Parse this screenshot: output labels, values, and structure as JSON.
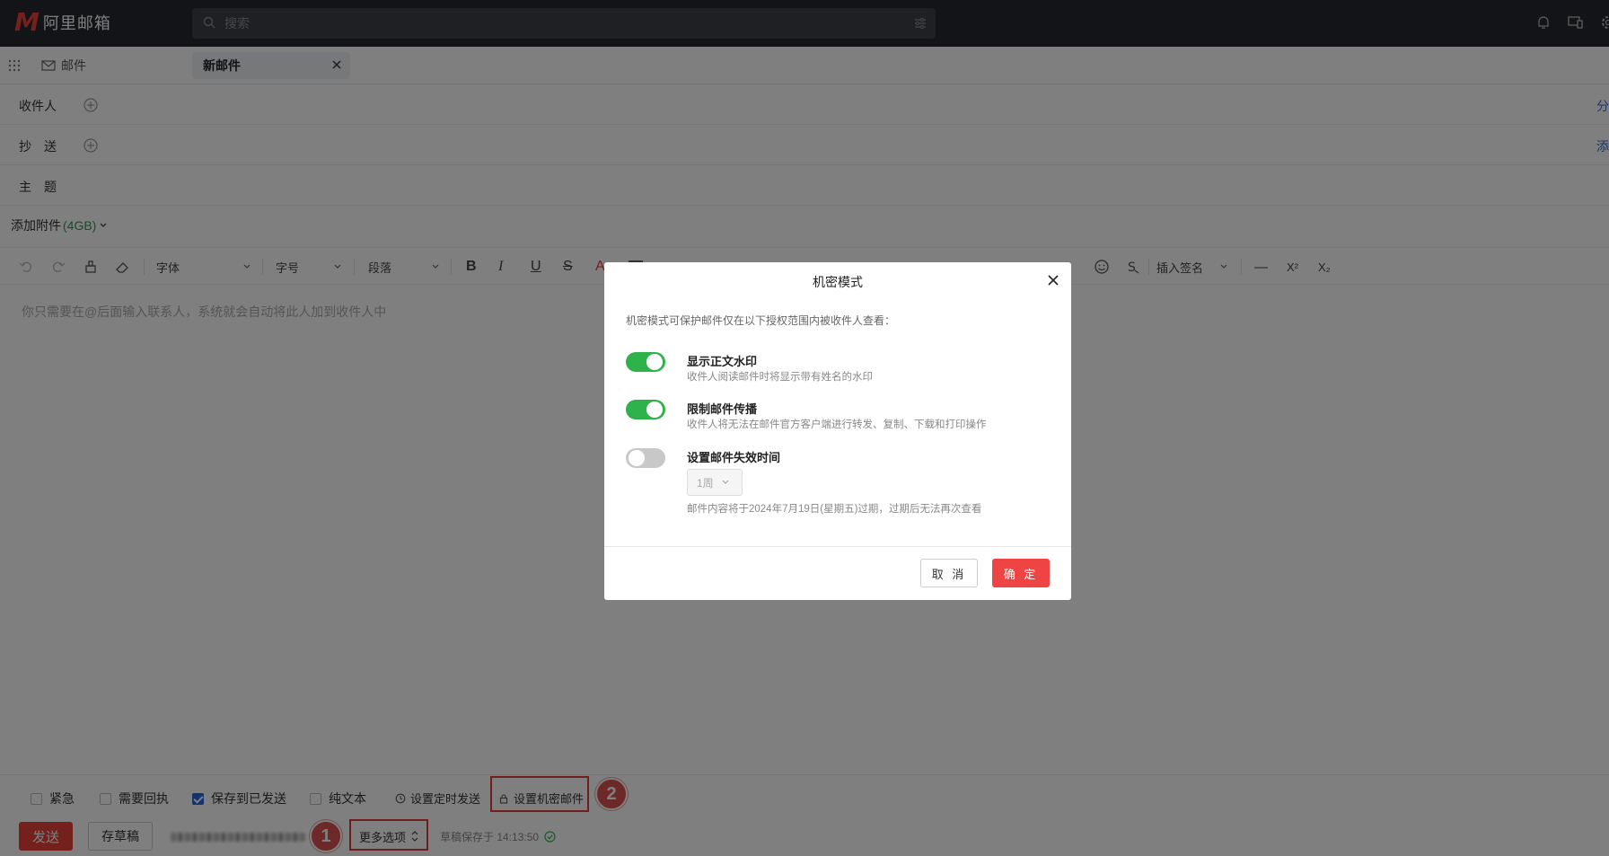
{
  "app": {
    "logo_letter": "M",
    "logo_text": "阿里邮箱",
    "brand_color": "#e8413a"
  },
  "search": {
    "placeholder": "搜索"
  },
  "tabs": {
    "mail_label": "邮件",
    "new_mail_label": "新邮件"
  },
  "compose": {
    "to_label": "收件人",
    "cc_label": "抄　送",
    "subject_label": "主　题",
    "to_right_link": "分",
    "cc_right_link": "添",
    "attach_label": "添加附件",
    "attach_size": "(4GB)",
    "body_placeholder": "你只需要在@后面输入联系人，系统就会自动将此人加到收件人中"
  },
  "toolbar": {
    "font_label": "字体",
    "size_label": "字号",
    "paragraph_label": "段落",
    "bold": "B",
    "italic": "I",
    "underline": "U",
    "strike": "S",
    "font_color": "A",
    "signature_label": "插入签名",
    "hr": "—",
    "superscript": "X²",
    "subscript": "X₂"
  },
  "options": {
    "urgent": {
      "label": "紧急",
      "checked": false
    },
    "receipt": {
      "label": "需要回执",
      "checked": false
    },
    "save_sent": {
      "label": "保存到已发送",
      "checked": true
    },
    "plain_text": {
      "label": "纯文本",
      "checked": false
    },
    "schedule_label": "设置定时发送",
    "confidential_label": "设置机密邮件"
  },
  "bottom": {
    "send_label": "发送",
    "draft_label": "存草稿",
    "more_label": "更多选项",
    "draft_status": "草稿保存于 14:13:50"
  },
  "annotations": {
    "badge_1": "1",
    "badge_2": "2"
  },
  "modal": {
    "title": "机密模式",
    "description": "机密模式可保护邮件仅在以下授权范围内被收件人查看：",
    "options": [
      {
        "title": "显示正文水印",
        "desc": "收件人阅读邮件时将显示带有姓名的水印",
        "enabled": true
      },
      {
        "title": "限制邮件传播",
        "desc": "收件人将无法在邮件官方客户端进行转发、复制、下载和打印操作",
        "enabled": true
      },
      {
        "title": "设置邮件失效时间",
        "desc": "邮件内容将于2024年7月19日(星期五)过期，过期后无法再次查看",
        "enabled": false
      }
    ],
    "period_value": "1周",
    "cancel_label": "取 消",
    "ok_label": "确 定"
  }
}
